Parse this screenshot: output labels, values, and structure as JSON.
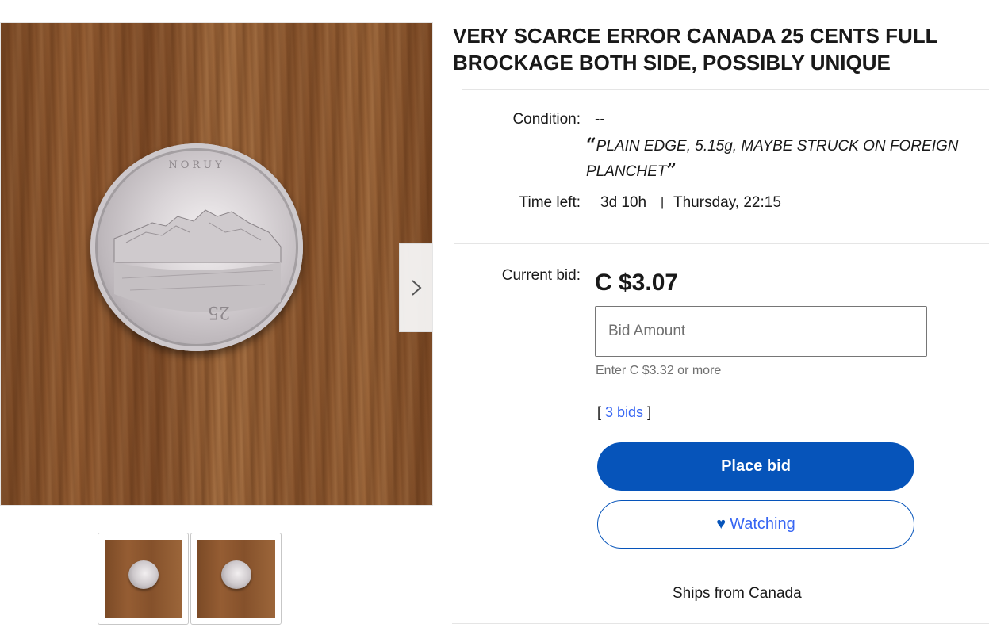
{
  "listing": {
    "title": "VERY SCARCE ERROR CANADA 25 CENTS FULL BROCKAGE BOTH SIDE, POSSIBLY UNIQUE"
  },
  "details": {
    "condition_label": "Condition:",
    "condition_value": "--",
    "condition_desc": "PLAIN EDGE, 5.15g, MAYBE STRUCK ON FOREIGN PLANCHET",
    "quote_open": "“",
    "quote_close": "”",
    "time_left_label": "Time left:",
    "time_left_value": "3d 10h",
    "time_separator": "|",
    "end_time": "Thursday, 22:15"
  },
  "bidding": {
    "current_bid_label": "Current bid:",
    "current_bid_value": "C $3.07",
    "bid_placeholder": "Bid Amount",
    "min_bid_hint": "Enter C $3.32 or more",
    "bids_open": "[ ",
    "bids_count": "3 bids",
    "bids_close": " ]",
    "place_bid_label": "Place bid",
    "watching_label": "Watching"
  },
  "shipping": {
    "ships_from": "Ships from Canada"
  },
  "gallery": {
    "next_icon": "chevron-right-icon",
    "thumbnails": [
      "coin-photo-1",
      "coin-photo-2"
    ]
  },
  "colors": {
    "primary": "#0654ba",
    "link": "#3665f3",
    "text": "#191919",
    "muted": "#707070"
  }
}
